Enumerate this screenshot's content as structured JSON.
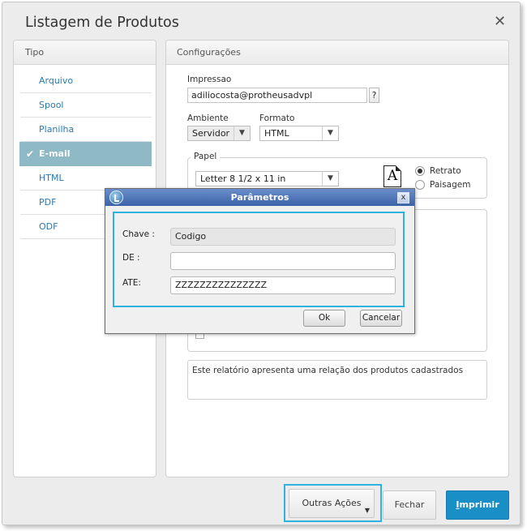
{
  "window": {
    "title": "Listagem de Produtos",
    "close_glyph": "✕"
  },
  "tipo": {
    "header": "Tipo",
    "items": [
      {
        "label": "Arquivo",
        "selected": false
      },
      {
        "label": "Spool",
        "selected": false
      },
      {
        "label": "Planilha",
        "selected": false
      },
      {
        "label": "E-mail",
        "selected": true
      },
      {
        "label": "HTML",
        "selected": false
      },
      {
        "label": "PDF",
        "selected": false
      },
      {
        "label": "ODF",
        "selected": false
      }
    ]
  },
  "config": {
    "header": "Configurações",
    "impressao_label": "Impressao",
    "impressao_value": "adiliocosta@protheusadvpl",
    "help_label": "?",
    "ambiente_label": "Ambiente",
    "ambiente_value": "Servidor",
    "formato_label": "Formato",
    "formato_value": "HTML",
    "papel_label": "Papel",
    "papel_value": "Letter 8 1/2 x 11 in",
    "paper_icon_letter": "A",
    "orientation": [
      {
        "label": "Retrato",
        "checked": true
      },
      {
        "label": "Paisagem",
        "checked": false
      }
    ],
    "description": "Este relatório apresenta uma relação dos produtos cadastrados"
  },
  "footer": {
    "outras_label": "Outras Ações",
    "fechar_label": "Fechar",
    "imprimir_first": "I",
    "imprimir_rest": "mprimir"
  },
  "modal": {
    "title": "Parâmetros",
    "close_glyph": "x",
    "fields": [
      {
        "label": "Chave :",
        "value": "Codigo",
        "readonly": true
      },
      {
        "label": "DE :",
        "value": "",
        "readonly": false
      },
      {
        "label": "ATE:",
        "value": "ZZZZZZZZZZZZZZZ",
        "readonly": false
      }
    ],
    "ok_label": "Ok",
    "cancel_label": "Cancelar"
  },
  "colors": {
    "accent": "#2fb1e1",
    "selected_bg": "#8fb9c4",
    "primary_button": "#1a8ec6",
    "link": "#2a7ab0",
    "modal_titlebar": "#3b63a8"
  }
}
